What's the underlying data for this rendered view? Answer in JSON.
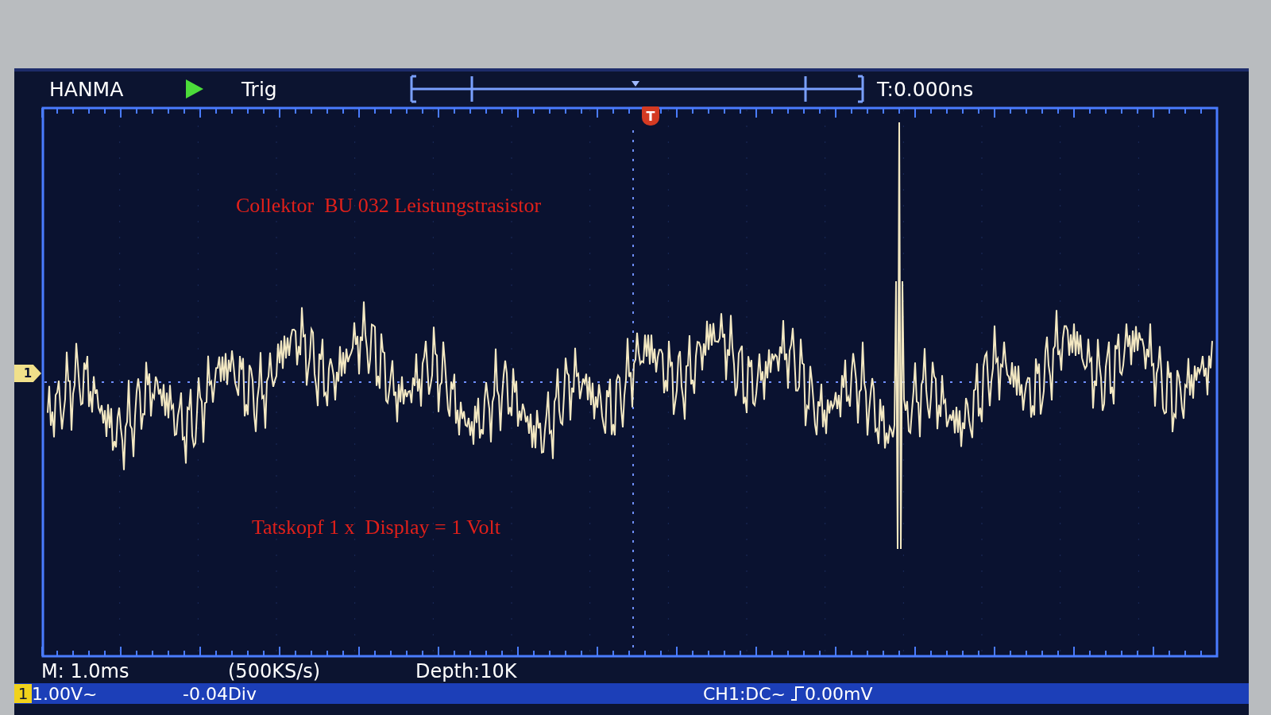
{
  "header": {
    "brand": "HANMA",
    "trigger_label": "Trig",
    "time_offset": "T:0.000ns"
  },
  "plot": {
    "trigger_marker": "T",
    "channel_marker": "1"
  },
  "annotations": [
    {
      "text": "Collektor  BU 032 Leistungstrasistor"
    },
    {
      "text": "Tatskopf 1 x  Display = 1 Volt"
    }
  ],
  "footer": {
    "timebase": "M: 1.0ms",
    "sample_rate": "(500KS/s)",
    "depth": "Depth:10K"
  },
  "channel_bar": {
    "channel": "1",
    "scale": "1.00V~",
    "offset": "-0.04Div",
    "coupling": "CH1:DC~",
    "trigger_level": "0.00mV"
  }
}
